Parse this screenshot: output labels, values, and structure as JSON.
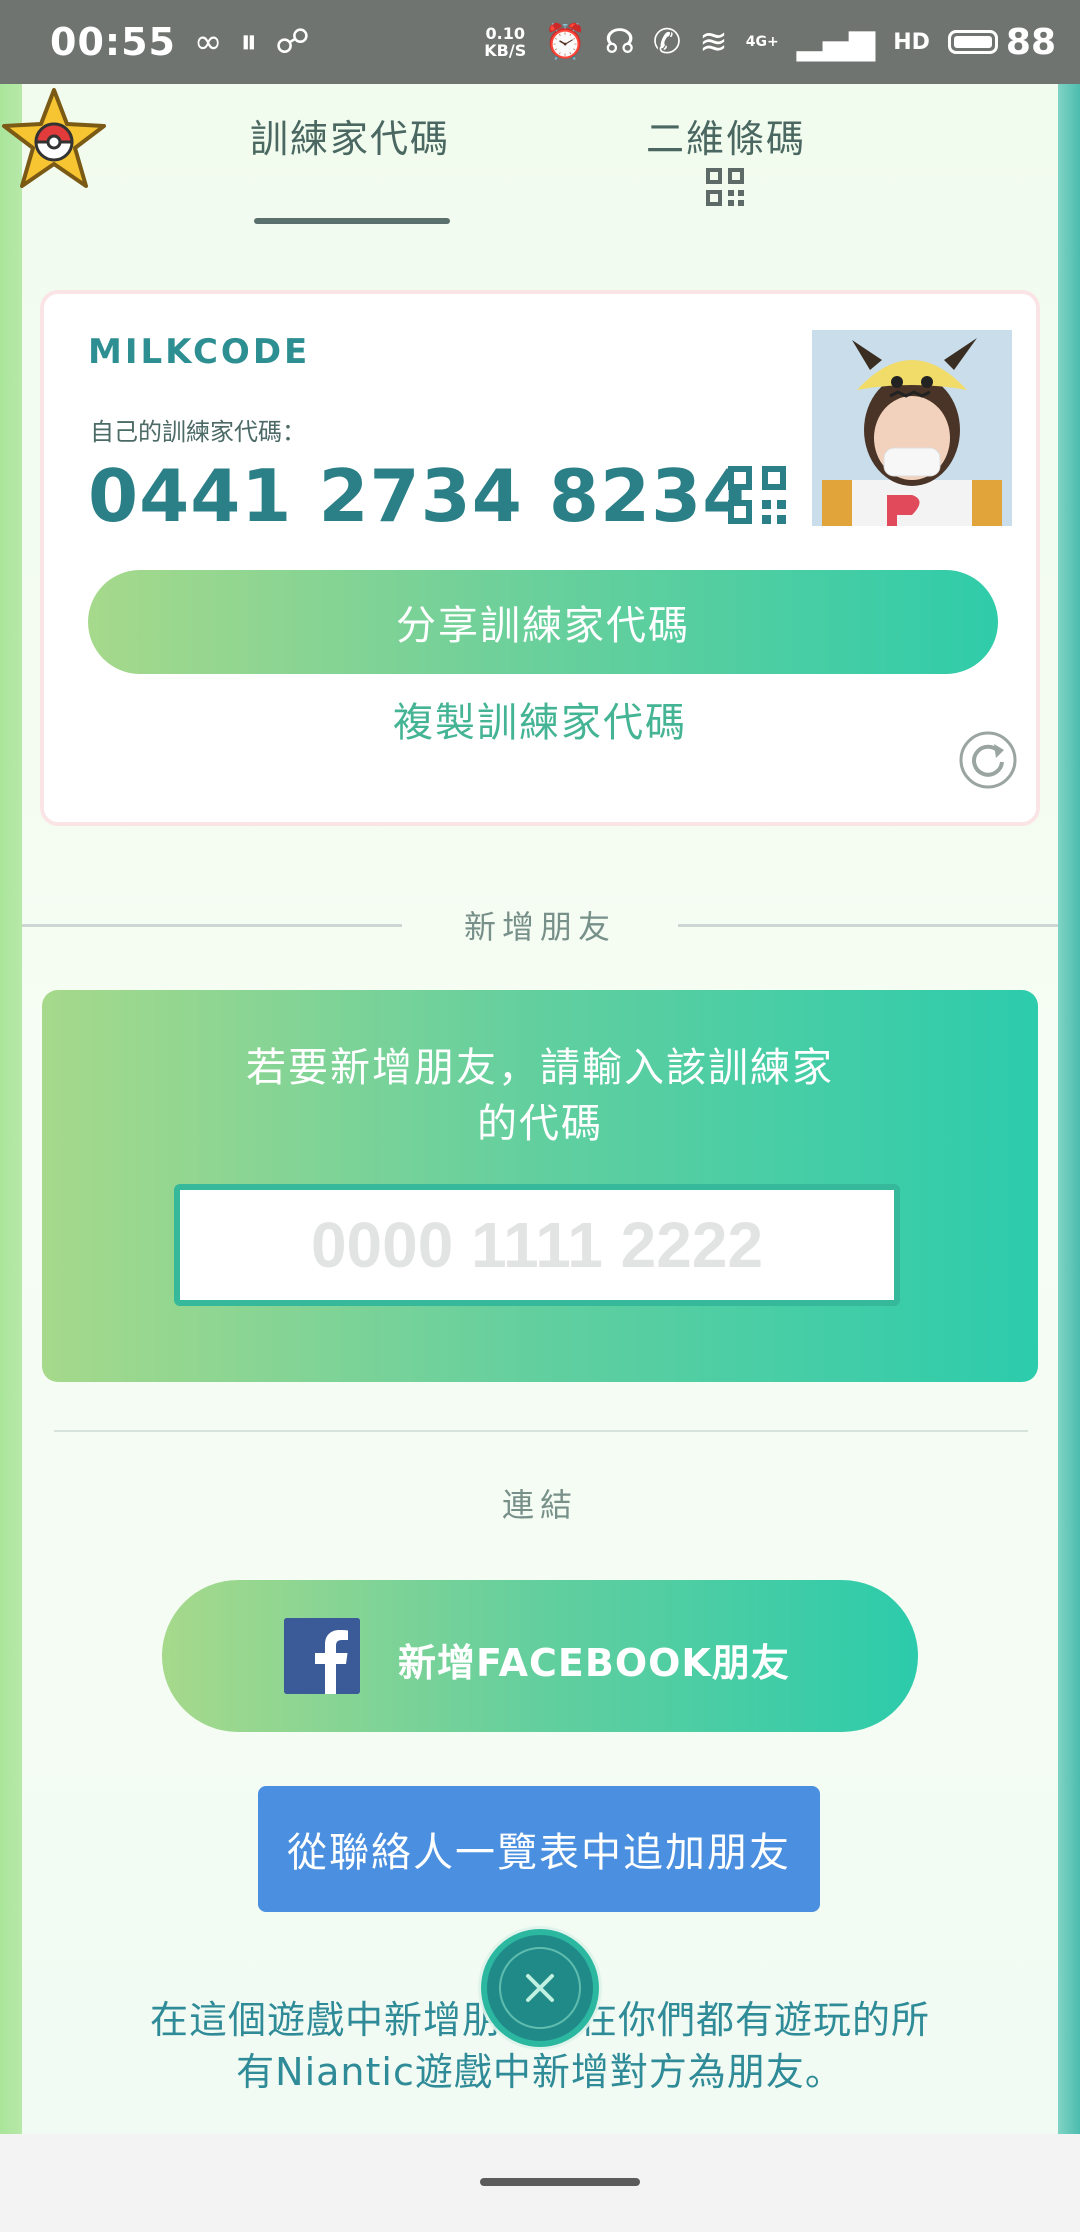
{
  "status_bar": {
    "time": "00:55",
    "net_speed_value": "0.10",
    "net_speed_unit": "KB/S",
    "network_type": "4G+",
    "hd_label": "HD",
    "battery": "88",
    "icons": [
      "infinity-icon",
      "pause-circle-icon",
      "link-icon",
      "alarm-icon",
      "headphones-icon",
      "phone-icon",
      "wifi-icon",
      "signal-icon",
      "battery-icon"
    ]
  },
  "tabs": {
    "trainer_code": "訓練家代碼",
    "qr_code": "二維條碼"
  },
  "card": {
    "trainer_name": "MILKCODE",
    "code_label": "自己的訓練家代碼：",
    "code": "0441 2734 8234",
    "share_label": "分享訓練家代碼",
    "copy_label": "複製訓練家代碼"
  },
  "add_friend": {
    "section_label": "新增朋友",
    "prompt_line1": "若要新增朋友，請輸入該訓練家",
    "prompt_line2": "的代碼",
    "input_placeholder": "0000 1111 2222",
    "input_value": ""
  },
  "connect": {
    "section_label": "連結",
    "facebook_label": "新增FACEBOOK朋友",
    "contacts_label": "從聯絡人一覽表中追加朋友"
  },
  "footnote": {
    "line1": "在這個遊戲中新增朋友，在你們都有遊玩的所",
    "line2": "有Niantic遊戲中新增對方為朋友。"
  },
  "colors": {
    "accent_teal": "#2b7f86",
    "gradient_start": "#a6d98b",
    "gradient_end": "#2cccac",
    "facebook_blue": "#3a5a98",
    "contacts_blue": "#4a8fe0"
  }
}
